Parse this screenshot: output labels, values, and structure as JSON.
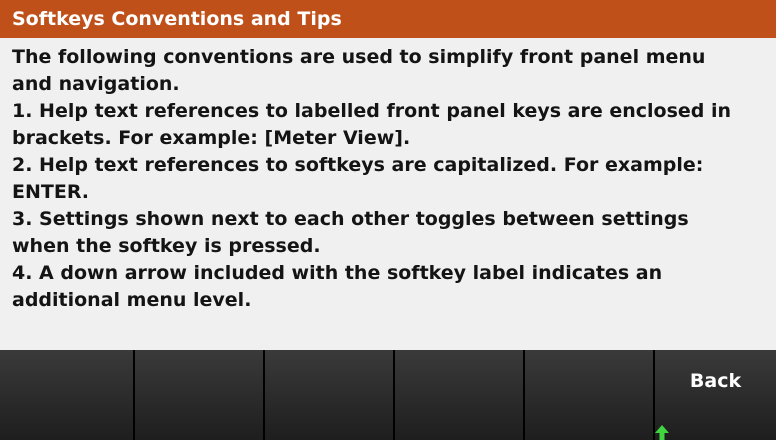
{
  "window": {
    "title": "Softkeys Conventions and Tips"
  },
  "help": {
    "lines": [
      "The following conventions are used to simplify front panel menu",
      "and navigation.",
      "1. Help text references to labelled front panel keys are enclosed in",
      "brackets. For example: [Meter View].",
      "2. Help text references to softkeys are capitalized. For example:",
      "ENTER.",
      "3. Settings shown next to each other toggles between settings",
      "when the softkey is pressed.",
      "4. A down arrow included with the softkey label indicates an",
      "additional menu level."
    ]
  },
  "softkeys": [
    {
      "label": ""
    },
    {
      "label": ""
    },
    {
      "label": ""
    },
    {
      "label": ""
    },
    {
      "label": ""
    },
    {
      "label": "Back",
      "icon": "up-arrow-icon"
    }
  ],
  "colors": {
    "title_bar": "#c0501a",
    "background": "#f0f0f0",
    "softkey": "#2c2c2c",
    "arrow": "#3fd63f"
  }
}
